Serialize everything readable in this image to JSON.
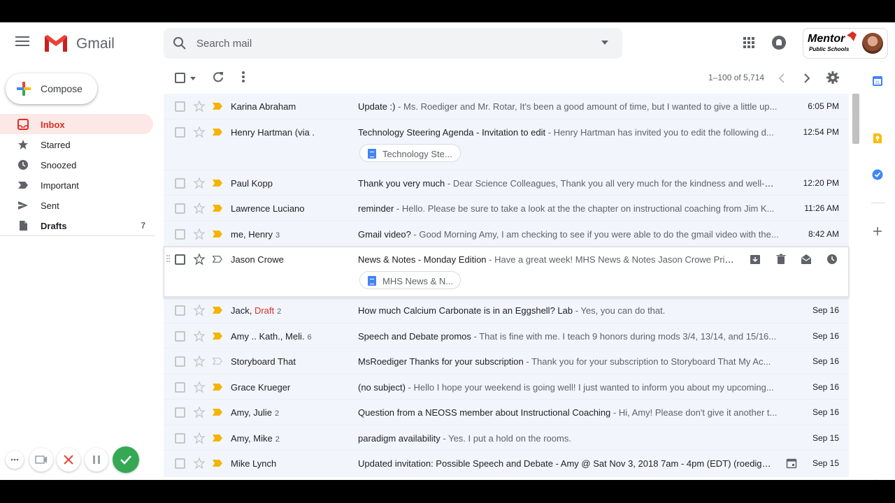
{
  "app": {
    "name": "Gmail"
  },
  "search": {
    "placeholder": "Search mail"
  },
  "account": {
    "org_line1": "Mentor",
    "org_line2": "Public Schools"
  },
  "compose": {
    "label": "Compose"
  },
  "sidebar": {
    "items": [
      {
        "label": "Inbox",
        "icon": "inbox-icon",
        "count": ""
      },
      {
        "label": "Starred",
        "icon": "star-icon",
        "count": ""
      },
      {
        "label": "Snoozed",
        "icon": "clock-icon",
        "count": ""
      },
      {
        "label": "Important",
        "icon": "important-icon",
        "count": ""
      },
      {
        "label": "Sent",
        "icon": "send-icon",
        "count": ""
      },
      {
        "label": "Drafts",
        "icon": "draft-icon",
        "count": "7"
      }
    ]
  },
  "toolbar": {
    "page_count": "1–100 of 5,714"
  },
  "emails": [
    {
      "sender": "Karina Abraham",
      "draft": "",
      "count": "",
      "subject": "Update :)",
      "snippet": " - Ms. Roediger and Mr. Rotar, It's been a good amount of time, but I wanted to give a little up...",
      "date": "6:05 PM",
      "important": true,
      "attachment": ""
    },
    {
      "sender": "Henry Hartman (via .",
      "draft": "",
      "count": "",
      "subject": "Technology Steering Agenda - Invitation to edit",
      "snippet": " - Henry Hartman has invited you to edit the following d...",
      "date": "12:54 PM",
      "important": true,
      "attachment": "Technology Ste..."
    },
    {
      "sender": "Paul Kopp",
      "draft": "",
      "count": "",
      "subject": "Thank you very much",
      "snippet": " - Dear Science Colleagues, Thank you all very much for the kindness and well-wi...",
      "date": "12:20 PM",
      "important": true,
      "attachment": ""
    },
    {
      "sender": "Lawrence Luciano",
      "draft": "",
      "count": "",
      "subject": "reminder",
      "snippet": " - Hello. Please be sure to take a look at the the chapter on instructional coaching from Jim K...",
      "date": "11:26 AM",
      "important": true,
      "attachment": ""
    },
    {
      "sender": "me, Henry",
      "draft": "",
      "count": "3",
      "subject": "Gmail video?",
      "snippet": " - Good Morning Amy, I am checking to see if you were able to do the gmail video with the...",
      "date": "8:42 AM",
      "important": true,
      "attachment": ""
    },
    {
      "sender": "Jason Crowe",
      "draft": "",
      "count": "",
      "subject": "News & Notes - Monday Edition",
      "snippet": " - Have a great week! MHS News & Notes Jason Crowe Prin...",
      "date": "",
      "important": false,
      "attachment": "MHS News & N..."
    },
    {
      "sender": "Jack, ",
      "draft": "Draft",
      "count": "2",
      "subject": "How much Calcium Carbonate is in an Eggshell? Lab",
      "snippet": " - Yes, you can do that.",
      "date": "Sep 16",
      "important": true,
      "attachment": ""
    },
    {
      "sender": "Amy .. Kath., Meli.",
      "draft": "",
      "count": "6",
      "subject": "Speech and Debate promos",
      "snippet": " - That is fine with me. I teach 9 honors during mods 3/4, 13/14, and 15/16...",
      "date": "Sep 16",
      "important": true,
      "attachment": ""
    },
    {
      "sender": "Storyboard That",
      "draft": "",
      "count": "",
      "subject": "MsRoediger Thanks for your subscription",
      "snippet": " - Thank you for your subscription to Storyboard That My Ac...",
      "date": "Sep 16",
      "important": false,
      "attachment": ""
    },
    {
      "sender": "Grace Krueger",
      "draft": "",
      "count": "",
      "subject": "(no subject)",
      "snippet": " - Hello I hope your weekend is going well! I just wanted to inform you about my upcoming...",
      "date": "Sep 16",
      "important": true,
      "attachment": ""
    },
    {
      "sender": "Amy, Julie",
      "draft": "",
      "count": "2",
      "subject": "Question from a NEOSS member about Instructional Coaching",
      "snippet": " - Hi, Amy! Please don't give it another t...",
      "date": "Sep 16",
      "important": true,
      "attachment": ""
    },
    {
      "sender": "Amy, Mike",
      "draft": "",
      "count": "2",
      "subject": "paradigm availability",
      "snippet": " - Yes. I put a hold on the rooms.",
      "date": "Sep 15",
      "important": true,
      "attachment": ""
    },
    {
      "sender": "Mike Lynch",
      "draft": "",
      "count": "",
      "subject": "Updated invitation: Possible Speech and Debate - Amy @ Sat Nov 3, 2018 7am - 4pm (EDT) (roediger...",
      "snippet": "",
      "date": "Sep 15",
      "important": true,
      "attachment": ""
    }
  ],
  "colors": {
    "accent": "#d93025",
    "important": "#f4b400",
    "active_bg": "#fce8e6",
    "read_row_bg": "#f2f6fc"
  }
}
